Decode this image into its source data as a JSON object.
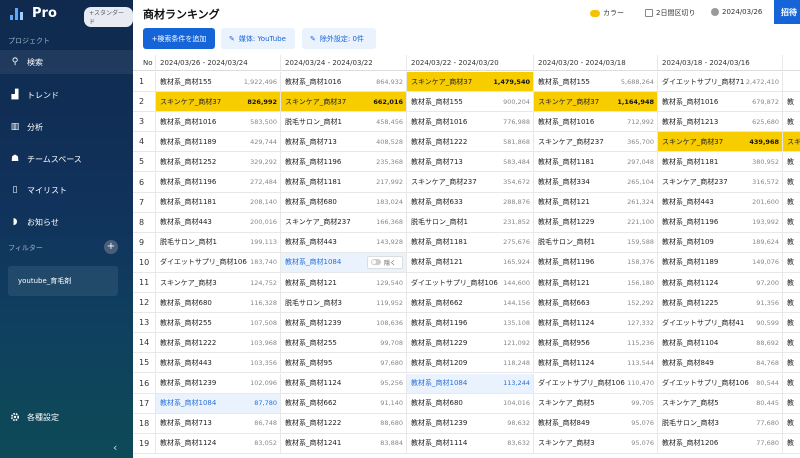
{
  "brand": {
    "name": "Pro",
    "plan_badge": "+スタンダード"
  },
  "sidebar": {
    "project_label": "プロジェクト",
    "items": [
      {
        "label": "検索",
        "icon": "search-icon",
        "glyph": "⚲",
        "active": true
      },
      {
        "label": "トレンド",
        "icon": "trend-icon",
        "glyph": "▟"
      },
      {
        "label": "分析",
        "icon": "bar-chart-icon",
        "glyph": "▥"
      },
      {
        "label": "チームスペース",
        "icon": "team-icon",
        "glyph": "☗"
      },
      {
        "label": "マイリスト",
        "icon": "bookmark-icon",
        "glyph": "▯"
      },
      {
        "label": "お知らせ",
        "icon": "bell-icon",
        "glyph": "◗"
      }
    ],
    "filter_label": "フィルター",
    "filter_add": "+",
    "filter_item": "youtube_育毛剤",
    "settings_label": "各種設定",
    "collapse_glyph": "‹"
  },
  "header": {
    "title": "商材ランキング",
    "color_label": "カラー",
    "period_label": "2日間区切り",
    "date_label": "2024/03/26",
    "invite_label": "招待"
  },
  "toolbar": {
    "search_condition": "+検索条件を追加",
    "media_chip": "媒体: YouTube",
    "exclude_chip": "除外設定: 0件"
  },
  "table": {
    "no_header": "No",
    "hide_label": "隠く",
    "columns": [
      "2024/03/26 - 2024/03/24",
      "2024/03/24 - 2024/03/22",
      "2024/03/22 - 2024/03/20",
      "2024/03/20 - 2024/03/18",
      "2024/03/18 - 2024/03/16",
      ""
    ],
    "rows": [
      {
        "no": "1",
        "cells": [
          {
            "name": "教材系_商材155",
            "value": "1,922,496"
          },
          {
            "name": "教材系_商材1016",
            "value": "864,932"
          },
          {
            "name": "スキンケア_商材37",
            "value": "1,479,540",
            "hl": true
          },
          {
            "name": "教材系_商材155",
            "value": "5,688,264"
          },
          {
            "name": "ダイエットサプリ_商材71",
            "value": "2,472,410"
          },
          {
            "name": "",
            "value": ""
          }
        ]
      },
      {
        "no": "2",
        "cells": [
          {
            "name": "スキンケア_商材37",
            "value": "826,992",
            "hl": true
          },
          {
            "name": "スキンケア_商材37",
            "value": "662,016",
            "hl": true
          },
          {
            "name": "教材系_商材155",
            "value": "900,204"
          },
          {
            "name": "スキンケア_商材37",
            "value": "1,164,948",
            "hl": true
          },
          {
            "name": "教材系_商材1016",
            "value": "679,872"
          },
          {
            "name": "教",
            "value": ""
          }
        ]
      },
      {
        "no": "3",
        "cells": [
          {
            "name": "教材系_商材1016",
            "value": "583,500"
          },
          {
            "name": "脱毛サロン_商材1",
            "value": "458,456"
          },
          {
            "name": "教材系_商材1016",
            "value": "776,988"
          },
          {
            "name": "教材系_商材1016",
            "value": "712,992"
          },
          {
            "name": "教材系_商材1213",
            "value": "625,680"
          },
          {
            "name": "教",
            "value": ""
          }
        ]
      },
      {
        "no": "4",
        "cells": [
          {
            "name": "教材系_商材1189",
            "value": "429,744"
          },
          {
            "name": "教材系_商材713",
            "value": "408,528"
          },
          {
            "name": "教材系_商材1222",
            "value": "581,868"
          },
          {
            "name": "スキンケア_商材237",
            "value": "365,700"
          },
          {
            "name": "スキンケア_商材37",
            "value": "439,968",
            "hl": true
          },
          {
            "name": "スキ",
            "value": "",
            "hl": true
          }
        ]
      },
      {
        "no": "5",
        "cells": [
          {
            "name": "教材系_商材1252",
            "value": "329,292"
          },
          {
            "name": "教材系_商材1196",
            "value": "235,368"
          },
          {
            "name": "教材系_商材713",
            "value": "583,484"
          },
          {
            "name": "教材系_商材1181",
            "value": "297,048"
          },
          {
            "name": "教材系_商材1181",
            "value": "380,952"
          },
          {
            "name": "教",
            "value": ""
          }
        ]
      },
      {
        "no": "6",
        "cells": [
          {
            "name": "教材系_商材1196",
            "value": "272,484"
          },
          {
            "name": "教材系_商材1181",
            "value": "217,992"
          },
          {
            "name": "スキンケア_商材237",
            "value": "354,672"
          },
          {
            "name": "教材系_商材334",
            "value": "265,104"
          },
          {
            "name": "スキンケア_商材237",
            "value": "316,572"
          },
          {
            "name": "教",
            "value": ""
          }
        ]
      },
      {
        "no": "7",
        "cells": [
          {
            "name": "教材系_商材1181",
            "value": "208,140"
          },
          {
            "name": "教材系_商材680",
            "value": "183,024"
          },
          {
            "name": "教材系_商材633",
            "value": "288,876"
          },
          {
            "name": "教材系_商材121",
            "value": "261,324"
          },
          {
            "name": "教材系_商材443",
            "value": "201,600"
          },
          {
            "name": "教",
            "value": ""
          }
        ]
      },
      {
        "no": "8",
        "cells": [
          {
            "name": "教材系_商材443",
            "value": "200,016"
          },
          {
            "name": "スキンケア_商材237",
            "value": "166,368"
          },
          {
            "name": "脱毛サロン_商材1",
            "value": "231,852"
          },
          {
            "name": "教材系_商材1229",
            "value": "221,100"
          },
          {
            "name": "教材系_商材1196",
            "value": "193,992"
          },
          {
            "name": "教",
            "value": ""
          }
        ]
      },
      {
        "no": "9",
        "cells": [
          {
            "name": "脱毛サロン_商材1",
            "value": "199,113"
          },
          {
            "name": "教材系_商材443",
            "value": "143,928"
          },
          {
            "name": "教材系_商材1181",
            "value": "275,676"
          },
          {
            "name": "脱毛サロン_商材1",
            "value": "159,588"
          },
          {
            "name": "教材系_商材109",
            "value": "189,624"
          },
          {
            "name": "教",
            "value": ""
          }
        ]
      },
      {
        "no": "10",
        "cells": [
          {
            "name": "ダイエットサプリ_商材106",
            "value": "183,740"
          },
          {
            "name": "教材系_商材1084",
            "value": "",
            "sel": true,
            "hide": true
          },
          {
            "name": "教材系_商材121",
            "value": "165,924"
          },
          {
            "name": "教材系_商材1196",
            "value": "158,376"
          },
          {
            "name": "教材系_商材1189",
            "value": "149,076"
          },
          {
            "name": "教",
            "value": ""
          }
        ]
      },
      {
        "no": "11",
        "cells": [
          {
            "name": "スキンケア_商材3",
            "value": "124,752"
          },
          {
            "name": "教材系_商材121",
            "value": "129,540"
          },
          {
            "name": "ダイエットサプリ_商材106",
            "value": "144,600"
          },
          {
            "name": "教材系_商材121",
            "value": "156,180"
          },
          {
            "name": "教材系_商材1124",
            "value": "97,200"
          },
          {
            "name": "教",
            "value": ""
          }
        ]
      },
      {
        "no": "12",
        "cells": [
          {
            "name": "教材系_商材680",
            "value": "116,328"
          },
          {
            "name": "脱毛サロン_商材3",
            "value": "119,952"
          },
          {
            "name": "教材系_商材662",
            "value": "144,156"
          },
          {
            "name": "教材系_商材663",
            "value": "152,292"
          },
          {
            "name": "教材系_商材1225",
            "value": "91,356"
          },
          {
            "name": "教",
            "value": ""
          }
        ]
      },
      {
        "no": "13",
        "cells": [
          {
            "name": "教材系_商材255",
            "value": "107,508"
          },
          {
            "name": "教材系_商材1239",
            "value": "108,636"
          },
          {
            "name": "教材系_商材1196",
            "value": "135,108"
          },
          {
            "name": "教材系_商材1124",
            "value": "127,332"
          },
          {
            "name": "ダイエットサプリ_商材41",
            "value": "90,599"
          },
          {
            "name": "教",
            "value": ""
          }
        ]
      },
      {
        "no": "14",
        "cells": [
          {
            "name": "教材系_商材1222",
            "value": "103,968"
          },
          {
            "name": "教材系_商材255",
            "value": "99,708"
          },
          {
            "name": "教材系_商材1229",
            "value": "121,092"
          },
          {
            "name": "教材系_商材956",
            "value": "115,236"
          },
          {
            "name": "教材系_商材1104",
            "value": "88,692"
          },
          {
            "name": "教",
            "value": ""
          }
        ]
      },
      {
        "no": "15",
        "cells": [
          {
            "name": "教材系_商材443",
            "value": "103,356"
          },
          {
            "name": "教材系_商材95",
            "value": "97,680"
          },
          {
            "name": "教材系_商材1209",
            "value": "118,248"
          },
          {
            "name": "教材系_商材1124",
            "value": "113,544"
          },
          {
            "name": "教材系_商材849",
            "value": "84,768"
          },
          {
            "name": "教",
            "value": ""
          }
        ]
      },
      {
        "no": "16",
        "cells": [
          {
            "name": "教材系_商材1239",
            "value": "102,096"
          },
          {
            "name": "教材系_商材1124",
            "value": "95,256"
          },
          {
            "name": "教材系_商材1084",
            "value": "113,244",
            "sel": true
          },
          {
            "name": "ダイエットサプリ_商材106",
            "value": "110,470"
          },
          {
            "name": "ダイエットサプリ_商材106",
            "value": "80,544"
          },
          {
            "name": "教",
            "value": ""
          }
        ]
      },
      {
        "no": "17",
        "cells": [
          {
            "name": "教材系_商材1084",
            "value": "87,780",
            "sel": true
          },
          {
            "name": "教材系_商材662",
            "value": "91,140"
          },
          {
            "name": "教材系_商材680",
            "value": "104,016"
          },
          {
            "name": "スキンケア_商材5",
            "value": "99,705"
          },
          {
            "name": "スキンケア_商材5",
            "value": "80,445"
          },
          {
            "name": "教",
            "value": ""
          }
        ]
      },
      {
        "no": "18",
        "cells": [
          {
            "name": "教材系_商材713",
            "value": "86,748"
          },
          {
            "name": "教材系_商材1222",
            "value": "88,680"
          },
          {
            "name": "教材系_商材1239",
            "value": "98,632"
          },
          {
            "name": "教材系_商材849",
            "value": "95,076"
          },
          {
            "name": "脱毛サロン_商材3",
            "value": "77,680"
          },
          {
            "name": "教",
            "value": ""
          }
        ]
      },
      {
        "no": "19",
        "cells": [
          {
            "name": "教材系_商材1124",
            "value": "83,052"
          },
          {
            "name": "教材系_商材1241",
            "value": "83,884"
          },
          {
            "name": "教材系_商材1114",
            "value": "83,632"
          },
          {
            "name": "スキンケア_商材3",
            "value": "95,076"
          },
          {
            "name": "教材系_商材1206",
            "value": "77,680"
          },
          {
            "name": "教",
            "value": ""
          }
        ]
      }
    ]
  }
}
